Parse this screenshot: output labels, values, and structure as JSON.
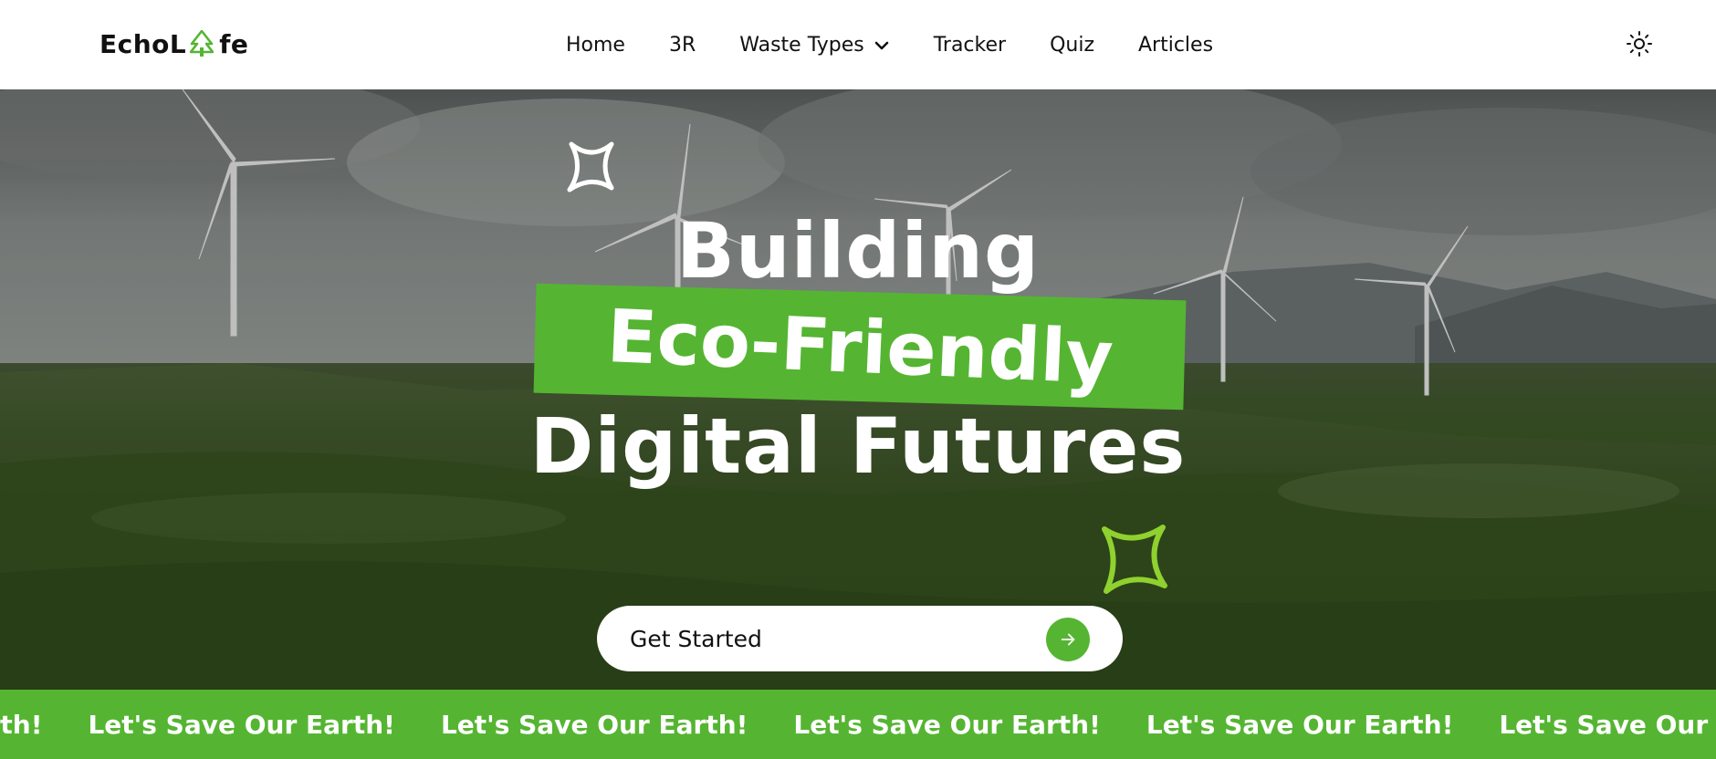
{
  "brand": {
    "name_part1": "EchoL",
    "name_part2": "fe",
    "logo_icon": "tree-icon"
  },
  "nav": {
    "items": [
      {
        "label": "Home"
      },
      {
        "label": "3R"
      },
      {
        "label": "Waste Types",
        "has_dropdown": true,
        "icon": "chevron-down-icon"
      },
      {
        "label": "Tracker"
      },
      {
        "label": "Quiz"
      },
      {
        "label": "Articles"
      }
    ],
    "theme_toggle_icon": "sun-icon"
  },
  "hero": {
    "line1": "Building",
    "highlight": "Eco-Friendly",
    "line3": "Digital Futures",
    "cta_label": "Get Started",
    "cta_icon": "arrow-right-icon",
    "decor_icons": [
      "sparkle-icon",
      "sparkle-icon"
    ]
  },
  "marquee": {
    "items": [
      "Let's Save Our Earth!",
      "Let's Save Our Earth!",
      "Let's Save Our Earth!",
      "Let's Save Our Earth!",
      "Let's Save Our Earth!",
      "Let's Save Our Earth!"
    ]
  },
  "colors": {
    "accent": "#55b532",
    "spark_green": "#8fd12e",
    "nav_bg": "#ffffff",
    "text_dark": "#111111",
    "text_light": "#ffffff"
  }
}
